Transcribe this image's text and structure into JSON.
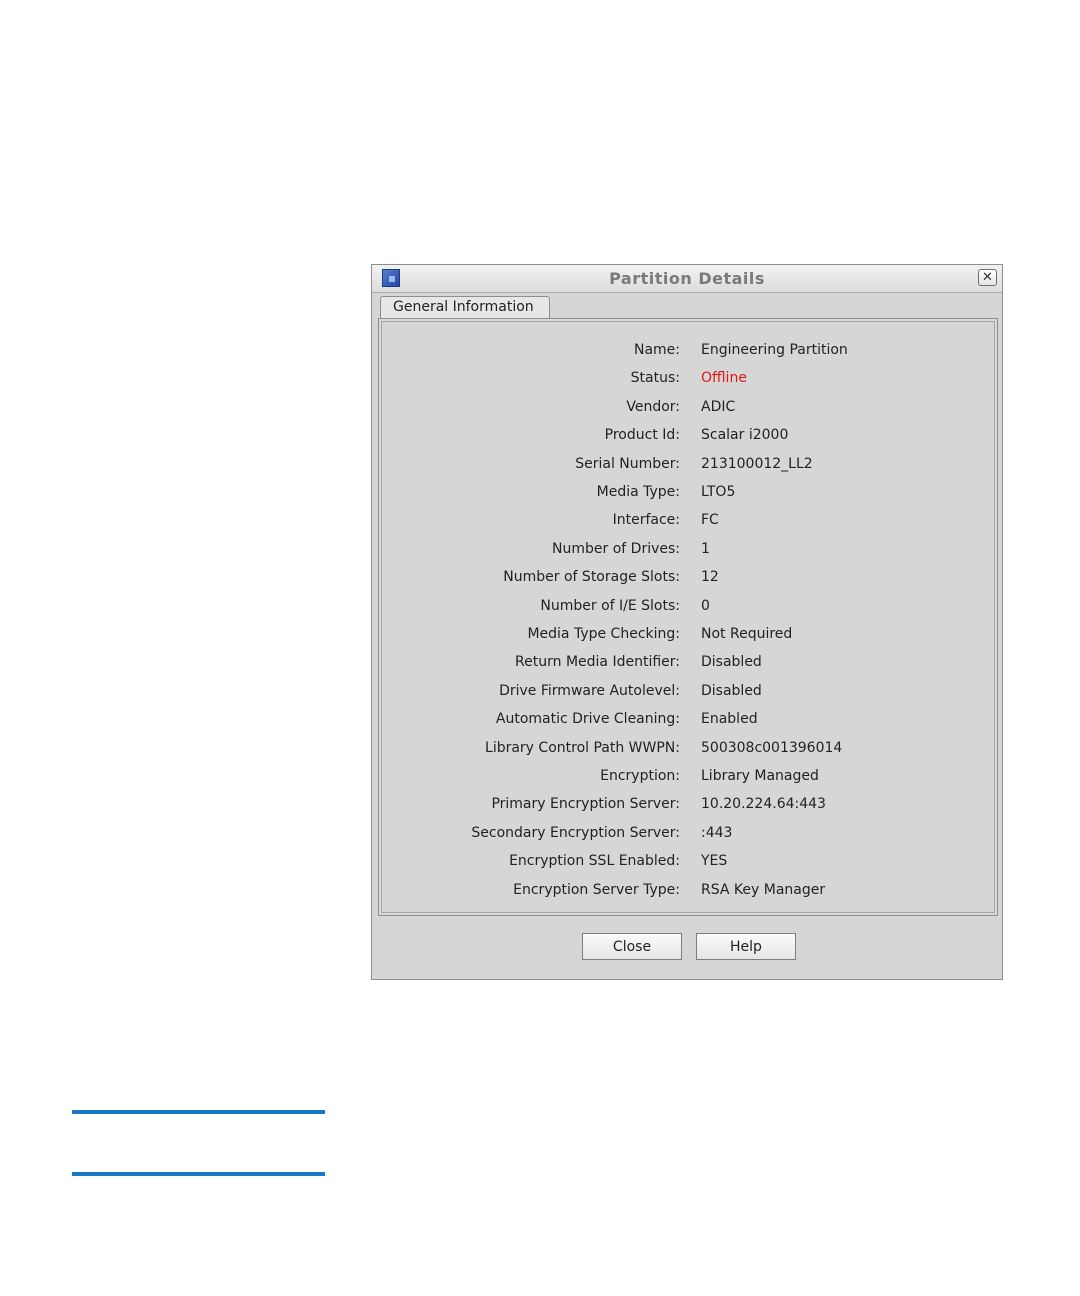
{
  "dialog": {
    "title": "Partition Details",
    "close_glyph": "✕",
    "icon": "app-icon"
  },
  "tabs": [
    {
      "label": "General Information"
    }
  ],
  "details": [
    {
      "label": "Name:",
      "value": "Engineering Partition"
    },
    {
      "label": "Status:",
      "value": "Offline"
    },
    {
      "label": "Vendor:",
      "value": "ADIC"
    },
    {
      "label": "Product Id:",
      "value": "Scalar i2000"
    },
    {
      "label": "Serial Number:",
      "value": "213100012_LL2"
    },
    {
      "label": "Media Type:",
      "value": "LTO5"
    },
    {
      "label": "Interface:",
      "value": "FC"
    },
    {
      "label": "Number of Drives:",
      "value": "1"
    },
    {
      "label": "Number of Storage Slots:",
      "value": "12"
    },
    {
      "label": "Number of I/E Slots:",
      "value": "0"
    },
    {
      "label": "Media Type Checking:",
      "value": "Not Required"
    },
    {
      "label": "Return Media Identifier:",
      "value": "Disabled"
    },
    {
      "label": "Drive Firmware Autolevel:",
      "value": "Disabled"
    },
    {
      "label": "Automatic Drive Cleaning:",
      "value": "Enabled"
    },
    {
      "label": "Library Control Path WWPN:",
      "value": "500308c001396014"
    },
    {
      "label": "Encryption:",
      "value": "Library Managed"
    },
    {
      "label": "Primary Encryption Server:",
      "value": "10.20.224.64:443"
    },
    {
      "label": "Secondary Encryption Server:",
      "value": ":443"
    },
    {
      "label": "Encryption SSL Enabled:",
      "value": "YES"
    },
    {
      "label": "Encryption Server Type:",
      "value": "RSA Key Manager"
    }
  ],
  "buttons": {
    "close_label": "Close",
    "help_label": "Help"
  },
  "colors": {
    "status_offline": "#e01818",
    "accent_rule": "#1a78c2"
  }
}
